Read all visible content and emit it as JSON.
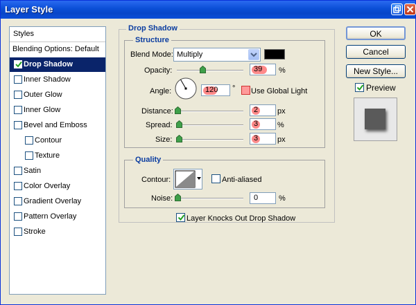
{
  "window": {
    "title": "Layer Style"
  },
  "styles": {
    "header": "Styles",
    "items": [
      {
        "label": "Blending Options: Default",
        "checkbox": false,
        "checked": false,
        "indent": 0,
        "selected": false
      },
      {
        "label": "Drop Shadow",
        "checkbox": true,
        "checked": true,
        "indent": 0,
        "selected": true
      },
      {
        "label": "Inner Shadow",
        "checkbox": true,
        "checked": false,
        "indent": 0,
        "selected": false
      },
      {
        "label": "Outer Glow",
        "checkbox": true,
        "checked": false,
        "indent": 0,
        "selected": false
      },
      {
        "label": "Inner Glow",
        "checkbox": true,
        "checked": false,
        "indent": 0,
        "selected": false
      },
      {
        "label": "Bevel and Emboss",
        "checkbox": true,
        "checked": false,
        "indent": 0,
        "selected": false
      },
      {
        "label": "Contour",
        "checkbox": true,
        "checked": false,
        "indent": 1,
        "selected": false
      },
      {
        "label": "Texture",
        "checkbox": true,
        "checked": false,
        "indent": 1,
        "selected": false
      },
      {
        "label": "Satin",
        "checkbox": true,
        "checked": false,
        "indent": 0,
        "selected": false
      },
      {
        "label": "Color Overlay",
        "checkbox": true,
        "checked": false,
        "indent": 0,
        "selected": false
      },
      {
        "label": "Gradient Overlay",
        "checkbox": true,
        "checked": false,
        "indent": 0,
        "selected": false
      },
      {
        "label": "Pattern Overlay",
        "checkbox": true,
        "checked": false,
        "indent": 0,
        "selected": false
      },
      {
        "label": "Stroke",
        "checkbox": true,
        "checked": false,
        "indent": 0,
        "selected": false
      }
    ]
  },
  "drop_shadow": {
    "section_title": "Drop Shadow",
    "structure": {
      "title": "Structure",
      "blend_mode_label": "Blend Mode:",
      "blend_mode_value": "Multiply",
      "shadow_color": "#000000",
      "opacity_label": "Opacity:",
      "opacity_value": "39",
      "opacity_unit": "%",
      "angle_label": "Angle:",
      "angle_value": "120",
      "angle_unit": "°",
      "use_global_light_label": "Use Global Light",
      "distance_label": "Distance:",
      "distance_value": "2",
      "distance_unit": "px",
      "spread_label": "Spread:",
      "spread_value": "3",
      "spread_unit": "%",
      "size_label": "Size:",
      "size_value": "3",
      "size_unit": "px"
    },
    "quality": {
      "title": "Quality",
      "contour_label": "Contour:",
      "anti_aliased_label": "Anti-aliased",
      "noise_label": "Noise:",
      "noise_value": "0",
      "noise_unit": "%"
    },
    "knockout_label": "Layer Knocks Out Drop Shadow"
  },
  "buttons": {
    "ok": "OK",
    "cancel": "Cancel",
    "new_style": "New Style...",
    "preview": "Preview"
  },
  "colors": {
    "highlight": "#ff8a8a",
    "title_bar": "#0a4ed6",
    "selection": "#0a246a"
  }
}
